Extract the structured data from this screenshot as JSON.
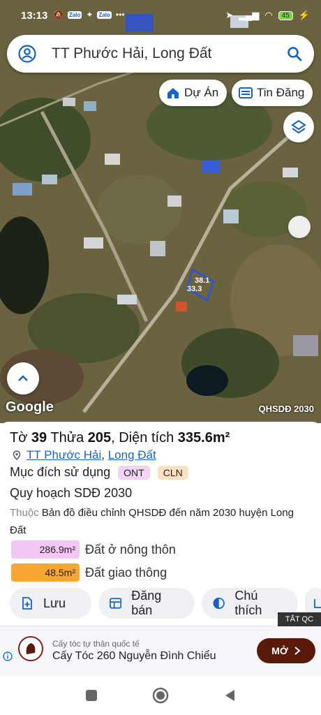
{
  "status_bar": {
    "time": "13:13",
    "zalo": "Zalo",
    "dots": "•••",
    "battery": "45"
  },
  "search": {
    "query": "TT Phước Hải, Long Đất"
  },
  "chips": {
    "du_an": "Dự Án",
    "tin_dang": "Tin Đăng"
  },
  "map": {
    "google_label": "Google",
    "layer_label": "QHSDĐ 2030",
    "plot_dim_top": "38.1",
    "plot_dim_side": "33.3"
  },
  "parcel": {
    "to_label": "Tờ",
    "to_value": "39",
    "thua_label": "Thửa",
    "thua_value": "205",
    "area_label": "Diện tích",
    "area_value": "335.6m²",
    "ward": "TT Phước Hải",
    "district": "Long Đất",
    "purpose_label": "Mục đích sử dụng",
    "purpose_tags": [
      "ONT",
      "CLN"
    ],
    "plan_label": "Quy hoạch SDĐ 2030",
    "belongs_label": "Thuộc",
    "belongs_text": "Bản đồ điều chỉnh QHSDĐ đến năm 2030 huyện Long Đất",
    "areas": [
      {
        "value": "286.9m²",
        "label": "Đất ở nông thôn",
        "color": "#f4c6f4"
      },
      {
        "value": "48.5m²",
        "label": "Đất giao thông",
        "color": "#f7a534"
      }
    ]
  },
  "actions": {
    "save": "Lưu",
    "post": "Đăng bán",
    "legend": "Chú thích"
  },
  "ad": {
    "tag": "TẮT QC",
    "small": "Cấy tóc tự thân quốc tế",
    "title": "Cấy Tóc 260 Nguyễn Đình Chiểu",
    "cta": "MỞ"
  }
}
